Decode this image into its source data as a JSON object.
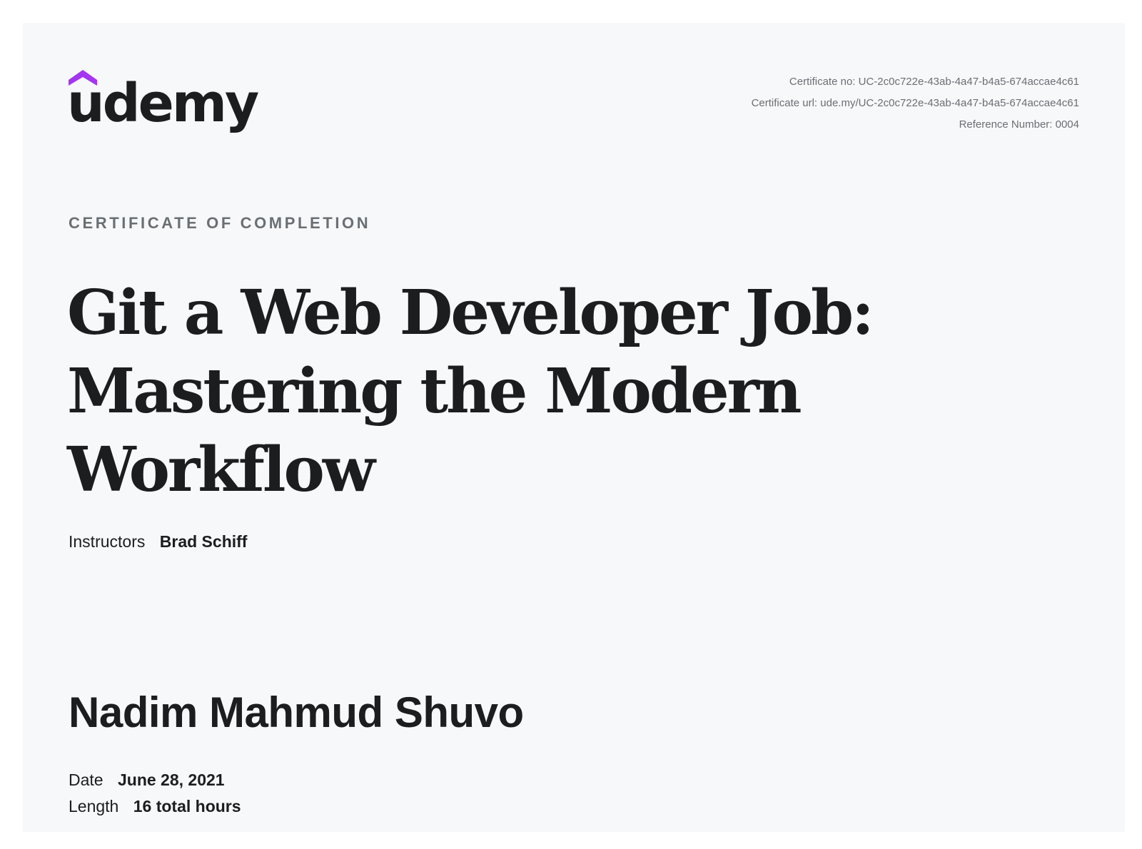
{
  "brand": {
    "logo_text": "udemy",
    "accent_color": "#a435f0",
    "text_color": "#1c1d1f"
  },
  "certificate_meta": {
    "certificate_no": "Certificate no: UC-2c0c722e-43ab-4a47-b4a5-674accae4c61",
    "certificate_url": "Certificate url: ude.my/UC-2c0c722e-43ab-4a47-b4a5-674accae4c61",
    "reference_number": "Reference Number: 0004"
  },
  "heading": {
    "kicker": "CERTIFICATE OF COMPLETION",
    "course_title": "Git a Web Developer Job: Mastering the Modern Workflow"
  },
  "instructors": {
    "label": "Instructors",
    "value": "Brad Schiff"
  },
  "recipient": {
    "name": "Nadim Mahmud Shuvo"
  },
  "details": {
    "date_label": "Date",
    "date_value": "June 28, 2021",
    "length_label": "Length",
    "length_value": "16 total hours"
  }
}
